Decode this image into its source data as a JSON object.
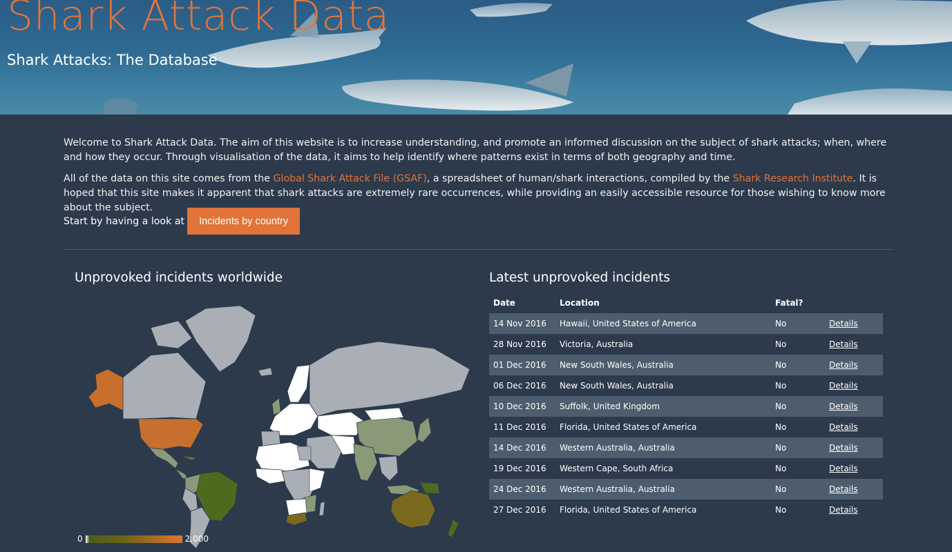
{
  "header": {
    "site_title": "Shark Attack Data",
    "subtitle": "Shark Attacks: The Database"
  },
  "intro": {
    "p1": "Welcome to Shark Attack Data. The aim of this website is to increase understanding, and promote an informed discussion on the subject of shark attacks; when, where and how they occur. Through visualisation of the data, it aims to help identify where patterns exist in terms of both geography and time.",
    "p2_before": "All of the data on this site comes from the ",
    "gsaf_link": "Global Shark Attack File (GSAF)",
    "p2_middle": ", a spreadsheet of human/shark interactions, compiled by the ",
    "sri_link": "Shark Research Institute",
    "p2_after": ". It is hoped that this site makes it apparent that shark attacks are extremely rare occurrences, while providing an easily accessible resource for those wishing to know more about the subject.",
    "cta_prefix": "Start by having a look at",
    "cta_button": "Incidents by country"
  },
  "map_panel": {
    "title": "Unprovoked incidents worldwide",
    "legend_min": "0",
    "legend_max": "2,000",
    "colors": {
      "high": "#c96f2e",
      "mid": "#7a6a1e",
      "low": "#4e6a1e",
      "lowest": "#8a9a78",
      "none": "#ffffff",
      "nodata": "#a9afb5"
    }
  },
  "table_panel": {
    "title": "Latest unprovoked incidents",
    "columns": [
      "Date",
      "Location",
      "Fatal?"
    ],
    "rows": [
      {
        "date": "14 Nov 2016",
        "location": "Hawaii, United States of America",
        "fatal": "No",
        "link": "Details"
      },
      {
        "date": "28 Nov 2016",
        "location": "Victoria, Australia",
        "fatal": "No",
        "link": "Details"
      },
      {
        "date": "01 Dec 2016",
        "location": "New South Wales, Australia",
        "fatal": "No",
        "link": "Details"
      },
      {
        "date": "06 Dec 2016",
        "location": "New South Wales, Australia",
        "fatal": "No",
        "link": "Details"
      },
      {
        "date": "10 Dec 2016",
        "location": "Suffolk, United Kingdom",
        "fatal": "No",
        "link": "Details"
      },
      {
        "date": "11 Dec 2016",
        "location": "Florida, United States of America",
        "fatal": "No",
        "link": "Details"
      },
      {
        "date": "14 Dec 2016",
        "location": "Western Australia, Australia",
        "fatal": "No",
        "link": "Details"
      },
      {
        "date": "19 Dec 2016",
        "location": "Western Cape, South Africa",
        "fatal": "No",
        "link": "Details"
      },
      {
        "date": "24 Dec 2016",
        "location": "Western Australia, Australia",
        "fatal": "No",
        "link": "Details"
      },
      {
        "date": "27 Dec 2016",
        "location": "Florida, United States of America",
        "fatal": "No",
        "link": "Details"
      }
    ]
  },
  "colors": {
    "accent": "#e0743a",
    "background": "#2c3a4c",
    "row_stripe": "#4e5d6d"
  }
}
